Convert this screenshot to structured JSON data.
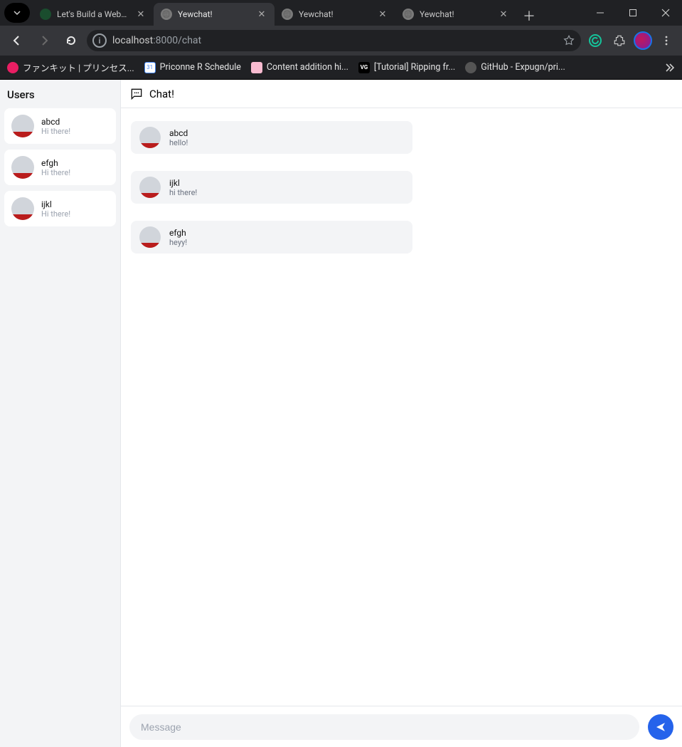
{
  "window": {
    "tabs": [
      {
        "title": "Let's Build a WebSo",
        "active": false,
        "favicon": "leaf"
      },
      {
        "title": "Yewchat!",
        "active": true,
        "favicon": "globe"
      },
      {
        "title": "Yewchat!",
        "active": false,
        "favicon": "globe"
      },
      {
        "title": "Yewchat!",
        "active": false,
        "favicon": "globe"
      }
    ]
  },
  "toolbar": {
    "address_host": "localhost",
    "address_rest": ":8000/chat"
  },
  "bookmarks": [
    {
      "label": "ファンキット | プリンセス...",
      "color": "#e91e63"
    },
    {
      "label": "Priconne R Schedule",
      "color": "#4285f4"
    },
    {
      "label": "Content addition hi...",
      "color": "#f8bbd0"
    },
    {
      "label": "[Tutorial] Ripping fr...",
      "color": "#000000",
      "text_icon": "VG"
    },
    {
      "label": "GitHub - Expugn/pri...",
      "color": "#555555"
    }
  ],
  "sidebar": {
    "title": "Users",
    "users": [
      {
        "name": "abcd",
        "status": "Hi there!"
      },
      {
        "name": "efgh",
        "status": "Hi there!"
      },
      {
        "name": "ijkl",
        "status": "Hi there!"
      }
    ]
  },
  "chat": {
    "title": "Chat!",
    "messages": [
      {
        "sender": "abcd",
        "text": "hello!"
      },
      {
        "sender": "ijkl",
        "text": "hi there!"
      },
      {
        "sender": "efgh",
        "text": "heyy!"
      }
    ],
    "input_placeholder": "Message"
  }
}
